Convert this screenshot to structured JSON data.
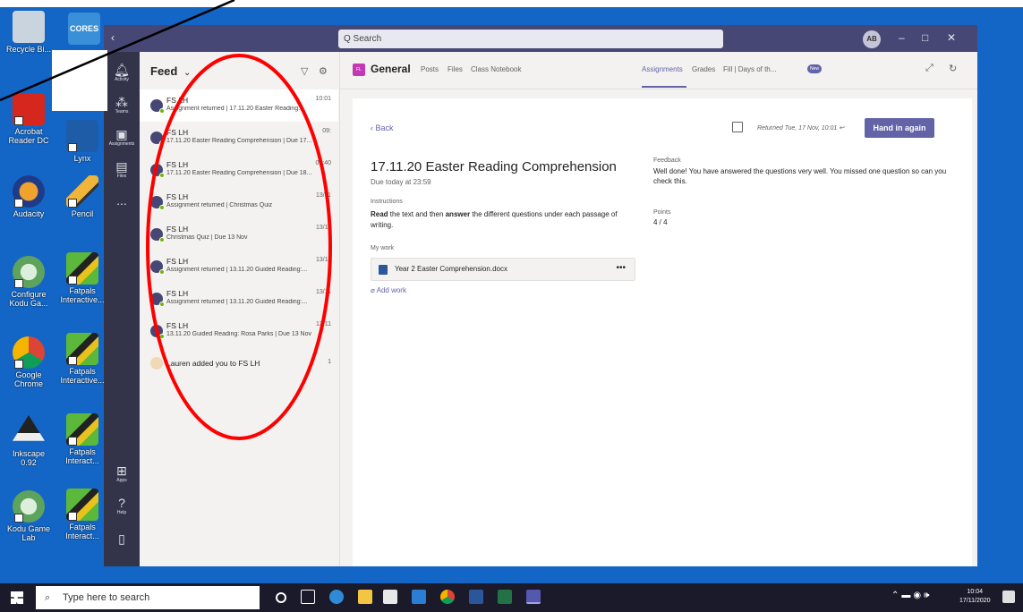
{
  "desktop": {
    "icons": [
      {
        "label": "Recycle Bi..."
      },
      {
        "label": "CORES"
      },
      {
        "label": "Acrobat Reader DC"
      },
      {
        "label": "Lynx"
      },
      {
        "label": "Audacity"
      },
      {
        "label": "Pencil"
      },
      {
        "label": "Configure Kodu Ga..."
      },
      {
        "label": "Fatpals Interactive..."
      },
      {
        "label": "Google Chrome"
      },
      {
        "label": "Fatpals Interactive..."
      },
      {
        "label": "Inkscape 0.92"
      },
      {
        "label": "Fatpals Interact..."
      },
      {
        "label": "Kodu Game Lab"
      },
      {
        "label": "Fatpals Interact..."
      }
    ]
  },
  "window": {
    "search_placeholder": "Q  Search",
    "user_initials": "AB",
    "min": "–",
    "max": "□",
    "close": "✕"
  },
  "rail": {
    "items": [
      {
        "label": "Activity",
        "icon": "bell-icon"
      },
      {
        "label": "Teams",
        "icon": "teams-icon"
      },
      {
        "label": "Assignments",
        "icon": "assignments-icon"
      },
      {
        "label": "Files",
        "icon": "file-icon"
      },
      {
        "label": "...",
        "icon": "more-icon"
      },
      {
        "label": "Apps",
        "icon": "apps-icon"
      },
      {
        "label": "Help",
        "icon": "help-icon"
      },
      {
        "label": "",
        "icon": "device-icon"
      }
    ]
  },
  "feed": {
    "title": "Feed",
    "chevron": "⌄",
    "filter_glyph": "▽",
    "settings_glyph": "⚙",
    "items": [
      {
        "title": "FS LH",
        "time": "10:01",
        "sub": "Assignment returned | 17.11.20 Easter Reading..."
      },
      {
        "title": "FS LH",
        "time": "09:",
        "sub": "17.11.20 Easter Reading Comprehension | Due 17..."
      },
      {
        "title": "FS LH",
        "time": "09:40",
        "sub": "17.11.20 Easter Reading Comprehension | Due 18..."
      },
      {
        "title": "FS LH",
        "time": "13/11",
        "sub": "Assignment returned | Christmas Quiz"
      },
      {
        "title": "FS LH",
        "time": "13/11",
        "sub": "Christmas Quiz | Due 13 Nov"
      },
      {
        "title": "FS LH",
        "time": "13/11",
        "sub": "Assignment returned | 13.11.20 Guided Reading:..."
      },
      {
        "title": "FS LH",
        "time": "13/11",
        "sub": "Assignment returned | 13.11.20 Guided Reading:..."
      },
      {
        "title": "FS LH",
        "time": "13/11",
        "sub": "13.11.20 Guided Reading: Rosa Parks | Due 13 Nov"
      },
      {
        "title": "Lauren added you to FS LH",
        "time": "1",
        "sub": ""
      }
    ]
  },
  "channel": {
    "badge": "FL",
    "name": "General",
    "tabs": [
      "Posts",
      "Files",
      "Class Notebook",
      "Assignments",
      "Grades",
      "Fill | Days of th..."
    ],
    "new_badge": "New"
  },
  "assignment": {
    "back": "Back",
    "returned": "Returned Tue, 17 Nov, 10:01",
    "hand_in": "Hand in again",
    "title": "17.11.20 Easter Reading Comprehension",
    "due": "Due today at 23:59",
    "instructions_label": "Instructions",
    "instructions_bold1": "Read",
    "instructions_mid": " the text and then ",
    "instructions_bold2": "answer",
    "instructions_rest": " the different questions under each passage of writing.",
    "my_work_label": "My work",
    "file_name": "Year 2 Easter Comprehension.docx",
    "file_more": "•••",
    "add_work": "Add work",
    "feedback_label": "Feedback",
    "feedback_text": "Well done! You have answered the questions very well.  You missed one question so can you check this.",
    "points_label": "Points",
    "points_value": "4 / 4"
  },
  "taskbar": {
    "search_placeholder": "Type here to search",
    "time": "10:04",
    "date": "17/11/2020"
  },
  "colors": {
    "teams_purple": "#6264a7",
    "titlebar": "#464775",
    "rail": "#33344a",
    "annotation_red": "#ff0000",
    "desktop_blue": "#1366c6"
  }
}
